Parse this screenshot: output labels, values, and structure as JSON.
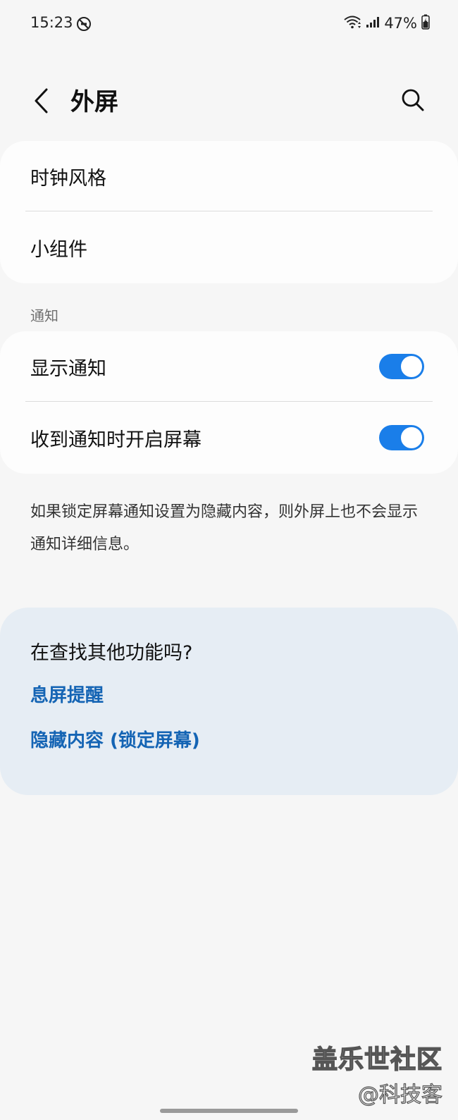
{
  "status_bar": {
    "time": "15:23",
    "battery": "47%",
    "icons": [
      "do-not-disturb-icon",
      "wifi-icon",
      "signal-icon",
      "battery-charging-icon"
    ]
  },
  "appbar": {
    "title": "外屏",
    "back_icon": "chevron-left-icon",
    "search_icon": "search-icon"
  },
  "display_group": {
    "items": [
      {
        "label": "时钟风格"
      },
      {
        "label": "小组件"
      }
    ]
  },
  "notifications": {
    "header": "通知",
    "items": [
      {
        "label": "显示通知",
        "enabled": true
      },
      {
        "label": "收到通知时开启屏幕",
        "enabled": true
      }
    ],
    "note": "如果锁定屏幕通知设置为隐藏内容，则外屏上也不会显示通知详细信息。"
  },
  "suggestions": {
    "title": "在查找其他功能吗?",
    "links": [
      "息屏提醒",
      "隐藏内容 (锁定屏幕)"
    ]
  },
  "watermark": {
    "line1": "盖乐世社区",
    "line2": "@科技客"
  },
  "colors": {
    "background": "#f6f6f6",
    "card": "#fdfdfd",
    "accent": "#1a7ee9",
    "link": "#1464b4",
    "suggest_bg": "#e6edf4"
  }
}
